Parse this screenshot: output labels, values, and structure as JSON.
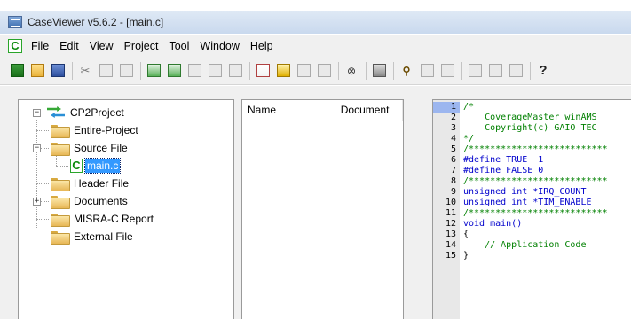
{
  "window": {
    "title": "CaseViewer v5.6.2 - [main.c]"
  },
  "menu": [
    "File",
    "Edit",
    "View",
    "Project",
    "Tool",
    "Window",
    "Help"
  ],
  "toolbar": {
    "icons": [
      "new-project-icon",
      "open-icon",
      "save-icon",
      "cut-icon",
      "copy-icon",
      "paste-icon",
      "analyze-icon",
      "analyze-all-icon",
      "report-icon",
      "export-html-icon",
      "export-word-icon",
      "coverage-icon",
      "graph-icon",
      "list-icon",
      "list2-icon",
      "stop-icon",
      "print-icon",
      "find-icon",
      "import-icon",
      "export-icon",
      "window-icon",
      "window2-icon",
      "window3-icon",
      "help-icon"
    ],
    "help_label": "?"
  },
  "tree": {
    "root": "CP2Project",
    "items": [
      {
        "label": "Entire-Project"
      },
      {
        "label": "Source File",
        "expanded": true,
        "children": [
          {
            "label": "main.c",
            "selected": true
          }
        ]
      },
      {
        "label": "Header File"
      },
      {
        "label": "Documents",
        "collapsed": true
      },
      {
        "label": "MISRA-C Report"
      },
      {
        "label": "External File"
      }
    ]
  },
  "list": {
    "columns": [
      "Name",
      "Document"
    ]
  },
  "code": {
    "current_line": 1,
    "lines": [
      {
        "n": "1",
        "text": "/*"
      },
      {
        "n": "2",
        "text": "    CoverageMaster winAMS"
      },
      {
        "n": "3",
        "text": "    Copyright(c) GAIO TEC"
      },
      {
        "n": "4",
        "text": "*/"
      },
      {
        "n": "5",
        "text": "/**************************"
      },
      {
        "n": "6",
        "text": "#define TRUE  1"
      },
      {
        "n": "7",
        "text": "#define FALSE 0"
      },
      {
        "n": "8",
        "text": "/**************************"
      },
      {
        "n": "9",
        "text": "unsigned int *IRQ_COUNT"
      },
      {
        "n": "10",
        "text": "unsigned int *TIM_ENABLE"
      },
      {
        "n": "11",
        "text": "/**************************"
      },
      {
        "n": "12",
        "text": "void main()"
      },
      {
        "n": "13",
        "text": "{"
      },
      {
        "n": "14",
        "text": "    // Application Code"
      },
      {
        "n": "15",
        "text": "}"
      }
    ]
  },
  "colors": {
    "selection": "#3399ff",
    "comment": "#008000",
    "keyword": "#0000cc",
    "gutter_current": "#9cb6ef"
  }
}
